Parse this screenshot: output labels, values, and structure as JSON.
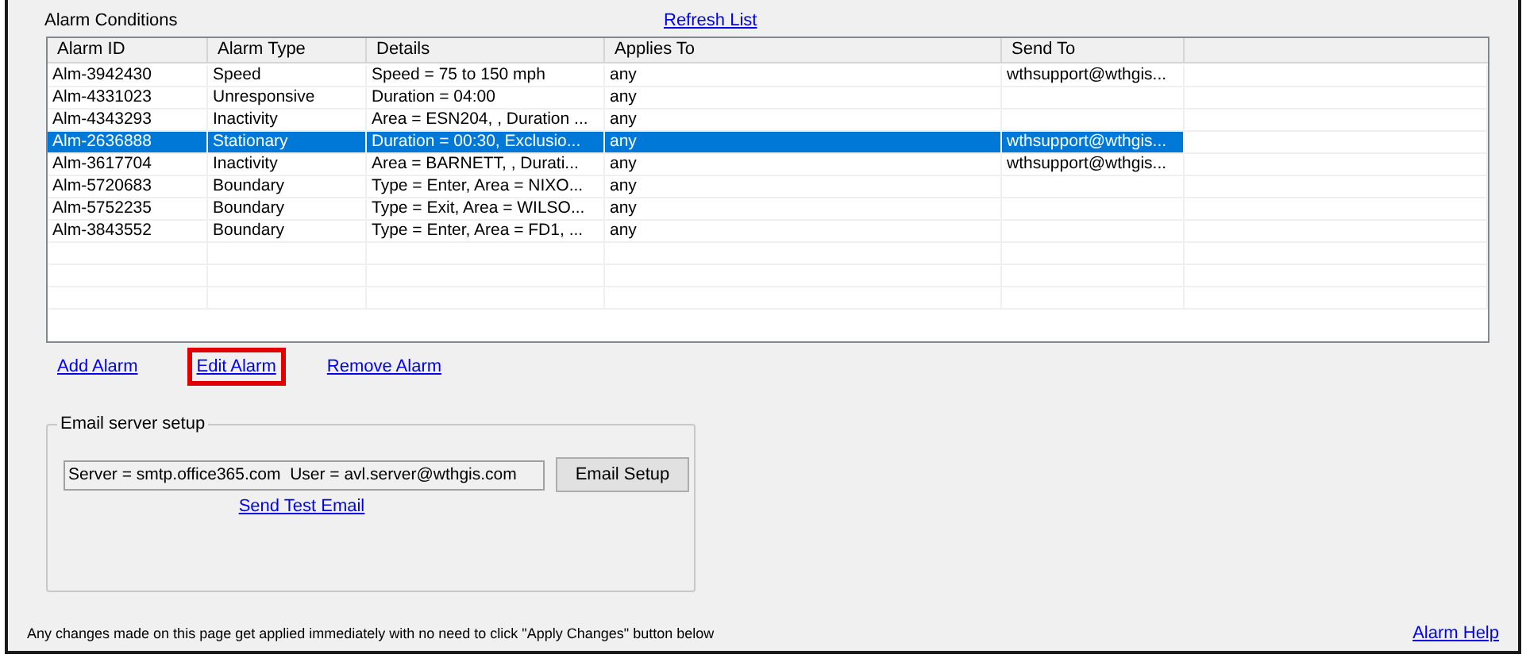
{
  "section_title": "Alarm Conditions",
  "refresh_link": "Refresh List",
  "table": {
    "columns": [
      "Alarm ID",
      "Alarm Type",
      "Details",
      "Applies To",
      "Send To"
    ],
    "rows": [
      {
        "alarm_id": "Alm-3942430",
        "alarm_type": "Speed",
        "details": "Speed = 75 to 150 mph",
        "applies_to": "any",
        "send_to": "wthsupport@wthgis...",
        "selected": false
      },
      {
        "alarm_id": "Alm-4331023",
        "alarm_type": "Unresponsive",
        "details": "Duration = 04:00",
        "applies_to": "any",
        "selected": false
      },
      {
        "alarm_id": "Alm-4343293",
        "alarm_type": "Inactivity",
        "details": "Area = ESN204, , Duration ...",
        "applies_to": "any",
        "selected": false
      },
      {
        "alarm_id": "Alm-2636888",
        "alarm_type": "Stationary",
        "details": "Duration = 00:30, Exclusio...",
        "applies_to": "any",
        "send_to": "wthsupport@wthgis...",
        "selected": true
      },
      {
        "alarm_id": "Alm-3617704",
        "alarm_type": "Inactivity",
        "details": "Area = BARNETT, , Durati...",
        "applies_to": "any",
        "send_to": "wthsupport@wthgis...",
        "selected": false
      },
      {
        "alarm_id": "Alm-5720683",
        "alarm_type": "Boundary",
        "details": "Type = Enter, Area = NIXO...",
        "applies_to": "any",
        "selected": false
      },
      {
        "alarm_id": "Alm-5752235",
        "alarm_type": "Boundary",
        "details": "Type = Exit, Area = WILSO...",
        "applies_to": "any",
        "selected": false
      },
      {
        "alarm_id": "Alm-3843552",
        "alarm_type": "Boundary",
        "details": "Type = Enter, Area = FD1, ...",
        "applies_to": "any",
        "selected": false
      }
    ]
  },
  "actions": [
    {
      "label": "Add Alarm",
      "highlighted": false
    },
    {
      "label": "Edit Alarm",
      "highlighted": true
    },
    {
      "label": "Remove Alarm",
      "highlighted": false
    }
  ],
  "email_group": {
    "title": "Email server setup",
    "server_field": "Server = smtp.office365.com  User = avl.server@wthgis.com",
    "setup_button": "Email Setup",
    "test_link": "Send Test Email"
  },
  "footer_note": "Any changes made on this page get applied immediately with no need to click \"Apply Changes\" button below",
  "help_link": "Alarm Help"
}
